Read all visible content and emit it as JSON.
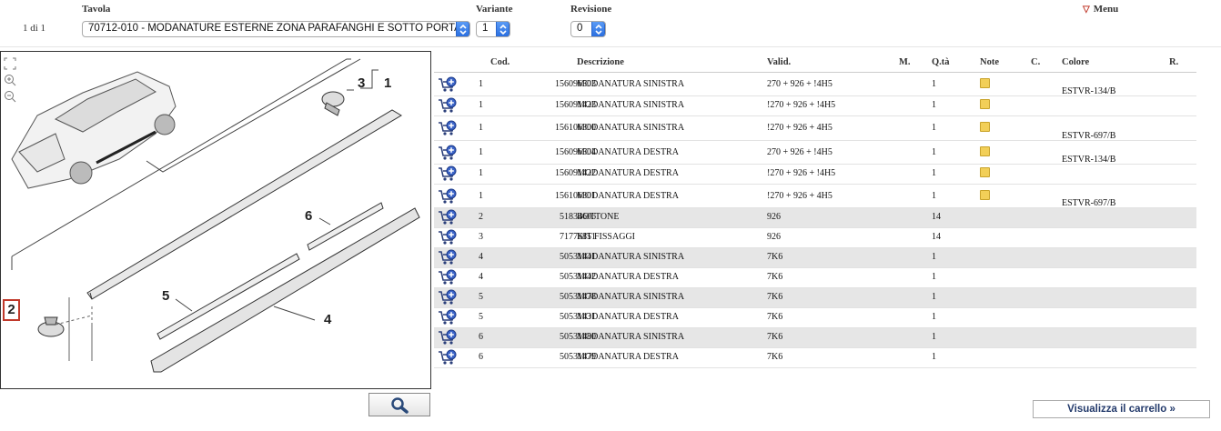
{
  "header": {
    "page_info": "1 di 1",
    "tavola_label": "Tavola",
    "tavola_value": "70712-010 - MODANATURE ESTERNE ZONA PARAFANGHI E SOTTO PORTA",
    "variante_label": "Variante",
    "variante_value": "1",
    "revisione_label": "Revisione",
    "revisione_value": "0",
    "menu_label": "Menu"
  },
  "diagram": {
    "callouts": [
      "1",
      "2",
      "3",
      "4",
      "5",
      "6"
    ],
    "highlighted_callout": "2"
  },
  "table": {
    "columns": [
      "Cod.",
      "Descrizione",
      "Valid.",
      "M.",
      "Q.tà",
      "Note",
      "C.",
      "Colore",
      "R."
    ],
    "rows": [
      {
        "ref": "1",
        "code": "156096503",
        "desc": "MODANATURA SINISTRA",
        "valid": "270 + 926 + !4H5",
        "qty": "1",
        "note": true,
        "color": "ESTVR-134/B",
        "gray": false
      },
      {
        "ref": "1",
        "code": "156091423",
        "desc": "MODANATURA SINISTRA",
        "valid": "!270 + 926 + !4H5",
        "qty": "1",
        "note": true,
        "color": "",
        "gray": false
      },
      {
        "ref": "1",
        "code": "156106300",
        "desc": "MODANATURA SINISTRA",
        "valid": "!270 + 926 + 4H5",
        "qty": "1",
        "note": true,
        "color": "ESTVR-697/B",
        "gray": false
      },
      {
        "ref": "1",
        "code": "156096504",
        "desc": "MODANATURA DESTRA",
        "valid": "270 + 926 + !4H5",
        "qty": "1",
        "note": true,
        "color": "ESTVR-134/B",
        "gray": false
      },
      {
        "ref": "1",
        "code": "156091422",
        "desc": "MODANATURA DESTRA",
        "valid": "!270 + 926 + !4H5",
        "qty": "1",
        "note": true,
        "color": "",
        "gray": false
      },
      {
        "ref": "1",
        "code": "156106301",
        "desc": "MODANATURA DESTRA",
        "valid": "!270 + 926 + 4H5",
        "qty": "1",
        "note": true,
        "color": "ESTVR-697/B",
        "gray": false
      },
      {
        "ref": "2",
        "code": "51834606",
        "desc": "BOTTONE",
        "valid": "926",
        "qty": "14",
        "note": false,
        "color": "",
        "gray": true
      },
      {
        "ref": "3",
        "code": "71776851",
        "desc": "KIT FISSAGGI",
        "valid": "926",
        "qty": "14",
        "note": false,
        "color": "",
        "gray": false
      },
      {
        "ref": "4",
        "code": "50531441",
        "desc": "MODANATURA SINISTRA",
        "valid": "7K6",
        "qty": "1",
        "note": false,
        "color": "",
        "gray": true
      },
      {
        "ref": "4",
        "code": "50531442",
        "desc": "MODANATURA DESTRA",
        "valid": "7K6",
        "qty": "1",
        "note": false,
        "color": "",
        "gray": false
      },
      {
        "ref": "5",
        "code": "50531478",
        "desc": "MODANATURA SINISTRA",
        "valid": "7K6",
        "qty": "1",
        "note": false,
        "color": "",
        "gray": true
      },
      {
        "ref": "5",
        "code": "50531431",
        "desc": "MODANATURA DESTRA",
        "valid": "7K6",
        "qty": "1",
        "note": false,
        "color": "",
        "gray": false
      },
      {
        "ref": "6",
        "code": "50531480",
        "desc": "MODANATURA SINISTRA",
        "valid": "7K6",
        "qty": "1",
        "note": false,
        "color": "",
        "gray": true
      },
      {
        "ref": "6",
        "code": "50531479",
        "desc": "MODANATURA DESTRA",
        "valid": "7K6",
        "qty": "1",
        "note": false,
        "color": "",
        "gray": false
      }
    ]
  },
  "footer": {
    "cart_button_label": "Visualizza il carrello »"
  },
  "colors": {
    "accent_blue": "#2a6fe0",
    "highlight_red": "#c0392b",
    "note_yellow": "#f2cf58",
    "row_gray": "#e6e6e6"
  },
  "icons": [
    "fit-icon",
    "zoom-in-icon",
    "zoom-out-icon",
    "magnifier-icon",
    "add-to-cart-icon",
    "note-icon",
    "menu-triangle-icon"
  ]
}
